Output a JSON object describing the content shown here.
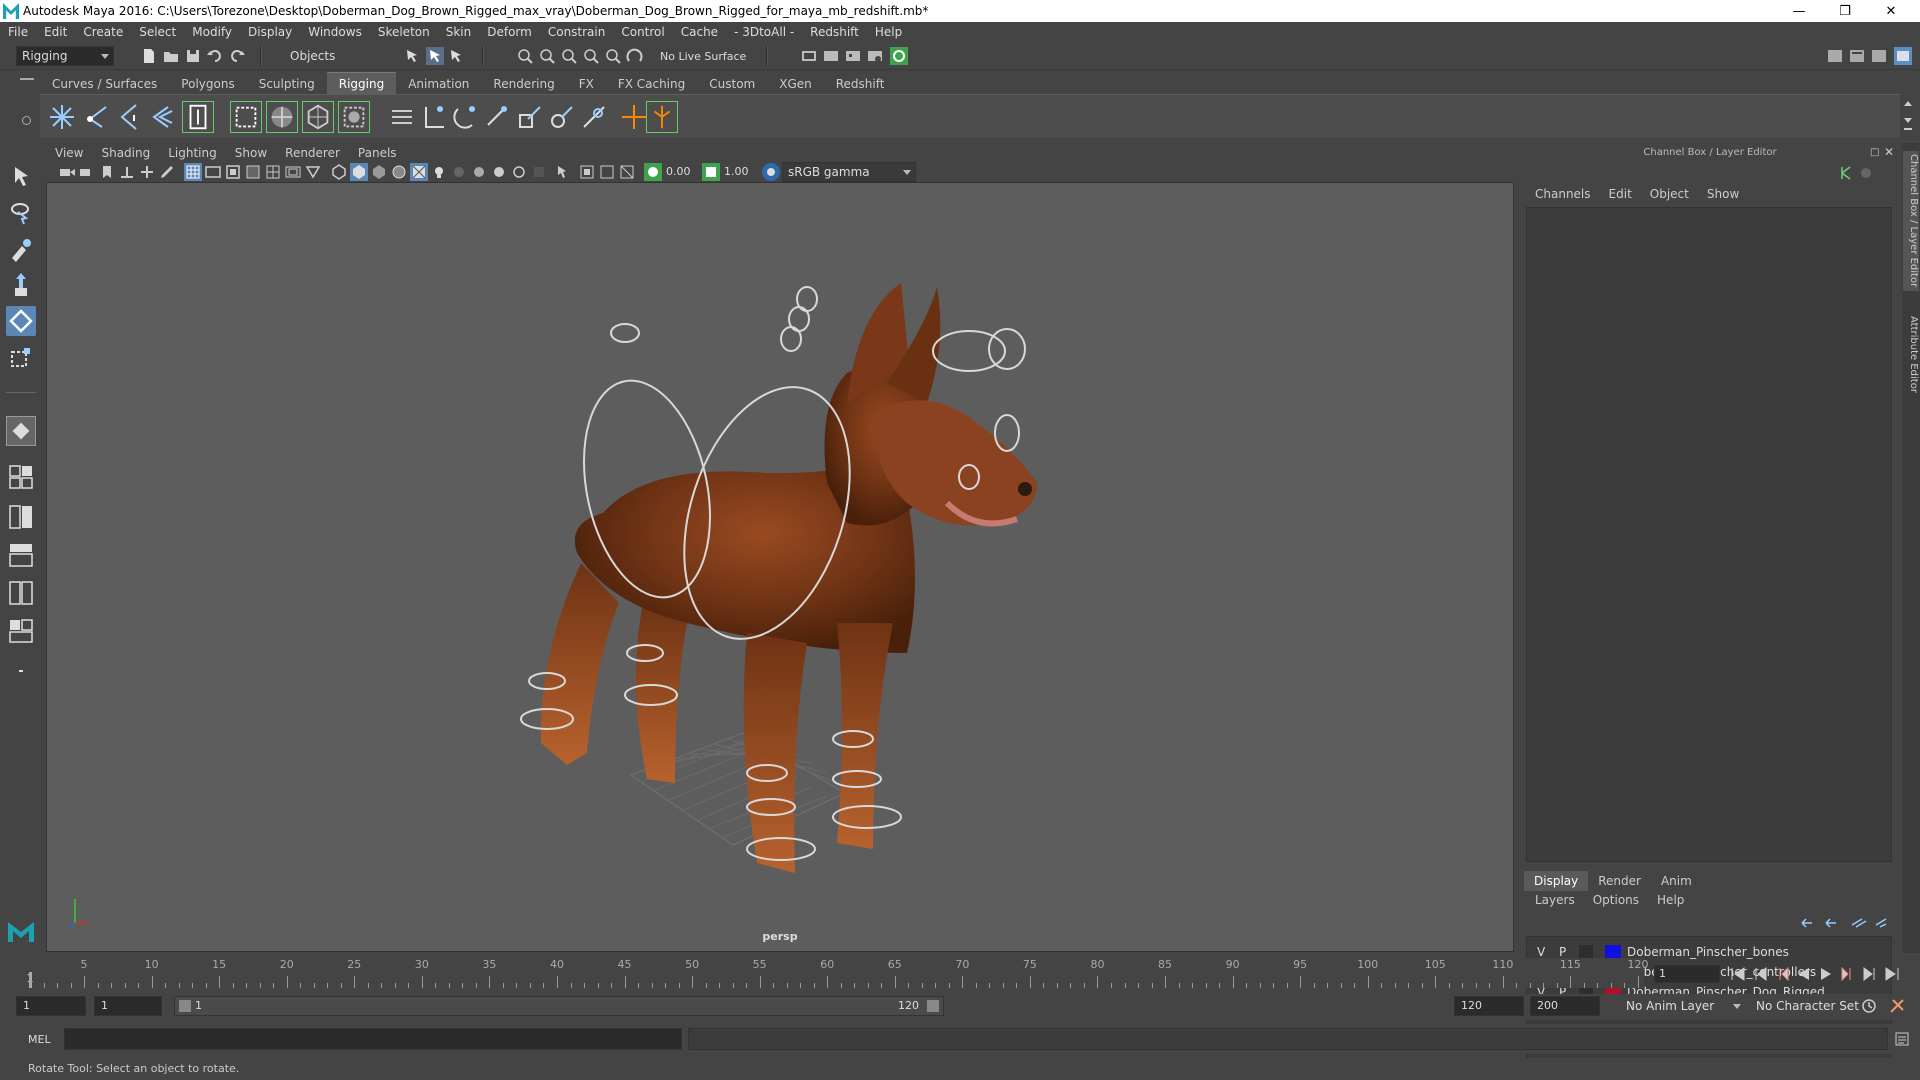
{
  "window": {
    "title": "Autodesk Maya 2016: C:\\Users\\Torezone\\Desktop\\Doberman_Dog_Brown_Rigged_max_vray\\Doberman_Dog_Brown_Rigged_for_maya_mb_redshift.mb*",
    "accent": "#1aa2b0"
  },
  "menubar": {
    "items": [
      "File",
      "Edit",
      "Create",
      "Select",
      "Modify",
      "Display",
      "Windows",
      "Skeleton",
      "Skin",
      "Deform",
      "Constrain",
      "Control",
      "Cache",
      "- 3DtoAll -",
      "Redshift",
      "Help"
    ]
  },
  "statusline": {
    "menuset": "Rigging",
    "selection_mode": "Objects",
    "live_surface": "No Live Surface"
  },
  "shelf": {
    "tabs": [
      "Curves / Surfaces",
      "Polygons",
      "Sculpting",
      "Rigging",
      "Animation",
      "Rendering",
      "FX",
      "FX Caching",
      "Custom",
      "XGen",
      "Redshift"
    ],
    "active_tab": "Rigging"
  },
  "viewport": {
    "menu": [
      "View",
      "Shading",
      "Lighting",
      "Show",
      "Renderer",
      "Panels"
    ],
    "exposure": "0.00",
    "gamma": "1.00",
    "color_space": "sRGB gamma",
    "camera": "persp"
  },
  "channelbox": {
    "title": "Channel Box / Layer Editor",
    "menu": [
      "Channels",
      "Edit",
      "Object",
      "Show"
    ]
  },
  "layer_editor": {
    "tabs": [
      "Display",
      "Render",
      "Anim"
    ],
    "active_tab": "Display",
    "menu": [
      "Layers",
      "Options",
      "Help"
    ],
    "layers": [
      {
        "v": "V",
        "p": "P",
        "name": "Doberman_Pinscher_bones",
        "color": "#1010e0"
      },
      {
        "v": "V",
        "p": "P",
        "name": "Doberman_Pinscher_controllers",
        "color": "#0b0b7a"
      },
      {
        "v": "V",
        "p": "P",
        "name": "Doberman_Pinscher_Dog_Rigged",
        "color": "#b0102a"
      }
    ]
  },
  "side_tabs": [
    "Channel Box / Layer Editor",
    "Attribute Editor"
  ],
  "timeslider": {
    "ticks": [
      5,
      10,
      15,
      20,
      25,
      30,
      35,
      40,
      45,
      50,
      55,
      60,
      65,
      70,
      75,
      80,
      85,
      90,
      95,
      100,
      105,
      110,
      115,
      120
    ],
    "start_label": "1",
    "current_frame": "1"
  },
  "range": {
    "start": "1",
    "playback_start": "1",
    "slider_start": "1",
    "slider_end": "120",
    "playback_end": "120",
    "end": "200",
    "anim_layer": "No Anim Layer",
    "character_set": "No Character Set"
  },
  "cmdline": {
    "label": "MEL"
  },
  "helpline": {
    "text": "Rotate Tool: Select an object to rotate."
  }
}
